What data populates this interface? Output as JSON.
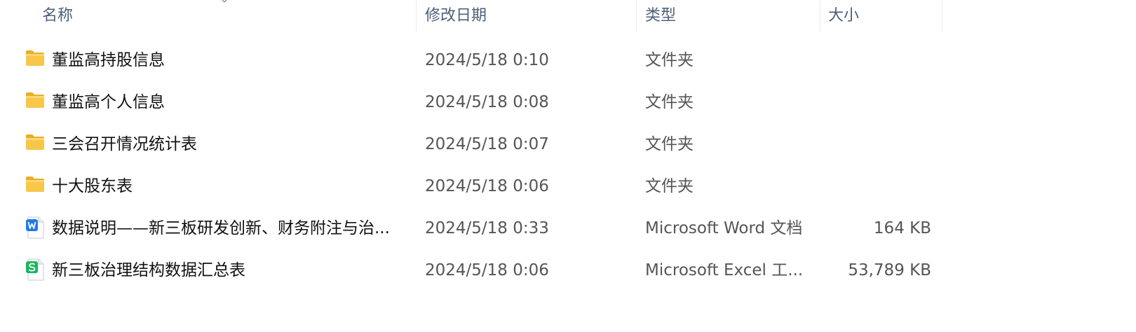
{
  "columns": {
    "name": "名称",
    "date": "修改日期",
    "type": "类型",
    "size": "大小"
  },
  "icons": {
    "folder": "folder-icon",
    "word": "word-doc-icon",
    "excel": "excel-sheet-icon",
    "sort": "sort-up-icon"
  },
  "colors": {
    "folder": "#f8c74a",
    "word": "#1f7ae8",
    "excel": "#1bb560",
    "header_text": "#4c607a"
  },
  "files": [
    {
      "name": "董监高持股信息",
      "date": "2024/5/18 0:10",
      "type": "文件夹",
      "size": ""
    },
    {
      "name": "董监高个人信息",
      "date": "2024/5/18 0:08",
      "type": "文件夹",
      "size": ""
    },
    {
      "name": "三会召开情况统计表",
      "date": "2024/5/18 0:07",
      "type": "文件夹",
      "size": ""
    },
    {
      "name": "十大股东表",
      "date": "2024/5/18 0:06",
      "type": "文件夹",
      "size": ""
    },
    {
      "name": "数据说明——新三板研发创新、财务附注与治...",
      "date": "2024/5/18 0:33",
      "type": "Microsoft Word 文档",
      "size": "164 KB"
    },
    {
      "name": "新三板治理结构数据汇总表",
      "date": "2024/5/18 0:06",
      "type": "Microsoft Excel 工...",
      "size": "53,789 KB"
    }
  ]
}
